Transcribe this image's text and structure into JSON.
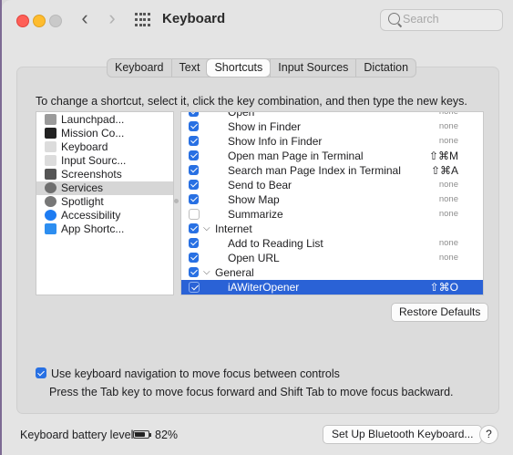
{
  "window": {
    "title": "Keyboard"
  },
  "search": {
    "placeholder": "Search"
  },
  "tabs": [
    {
      "label": "Keyboard",
      "active": false
    },
    {
      "label": "Text",
      "active": false
    },
    {
      "label": "Shortcuts",
      "active": true
    },
    {
      "label": "Input Sources",
      "active": false
    },
    {
      "label": "Dictation",
      "active": false
    }
  ],
  "instructions": "To change a shortcut, select it, click the key combination, and then type the new keys.",
  "categories": [
    {
      "label": "Launchpad...",
      "icon": "launchpad-icon",
      "color": "#9a9a9a"
    },
    {
      "label": "Mission Co...",
      "icon": "mission-control-icon",
      "color": "#222222"
    },
    {
      "label": "Keyboard",
      "icon": "keyboard-icon",
      "color": "#dcdcdc"
    },
    {
      "label": "Input Sourc...",
      "icon": "input-sources-icon",
      "color": "#dcdcdc"
    },
    {
      "label": "Screenshots",
      "icon": "screenshot-icon",
      "color": "#555555"
    },
    {
      "label": "Services",
      "icon": "gear-icon",
      "color": "#6f6f6f",
      "selected": true
    },
    {
      "label": "Spotlight",
      "icon": "spotlight-icon",
      "color": "#777777"
    },
    {
      "label": "Accessibility",
      "icon": "accessibility-icon",
      "color": "#1e7cf2"
    },
    {
      "label": "App Shortc...",
      "icon": "app-store-icon",
      "color": "#2d8ef0"
    }
  ],
  "services": [
    {
      "name": "Open",
      "shortcut": "none",
      "checked": true,
      "indent": 2
    },
    {
      "name": "Show in Finder",
      "shortcut": "none",
      "checked": true,
      "indent": 2
    },
    {
      "name": "Show Info in Finder",
      "shortcut": "none",
      "checked": true,
      "indent": 2
    },
    {
      "name": "Open man Page in Terminal",
      "shortcut": "⇧⌘M",
      "checked": true,
      "indent": 2
    },
    {
      "name": "Search man Page Index in Terminal",
      "shortcut": "⇧⌘A",
      "checked": true,
      "indent": 2
    },
    {
      "name": "Send to Bear",
      "shortcut": "none",
      "checked": true,
      "indent": 2
    },
    {
      "name": "Show Map",
      "shortcut": "none",
      "checked": true,
      "indent": 2
    },
    {
      "name": "Summarize",
      "shortcut": "none",
      "checked": false,
      "indent": 2
    },
    {
      "name": "Internet",
      "shortcut": "",
      "checked": true,
      "indent": 1,
      "group": true
    },
    {
      "name": "Add to Reading List",
      "shortcut": "none",
      "checked": true,
      "indent": 2
    },
    {
      "name": "Open URL",
      "shortcut": "none",
      "checked": true,
      "indent": 2
    },
    {
      "name": "General",
      "shortcut": "",
      "checked": true,
      "indent": 1,
      "group": true
    },
    {
      "name": "iAWiterOpener",
      "shortcut": "⇧⌘O",
      "checked": true,
      "indent": 2,
      "selected": true
    }
  ],
  "restore_defaults": "Restore Defaults",
  "keyboard_nav": {
    "label": "Use keyboard navigation to move focus between controls",
    "checked": true,
    "help": "Press the Tab key to move focus forward and Shift Tab to move focus backward."
  },
  "battery": {
    "label": "Keyboard battery level:",
    "percent": "82%",
    "level": 0.82
  },
  "bluetooth_button": "Set Up Bluetooth Keyboard...",
  "help_button": "?"
}
